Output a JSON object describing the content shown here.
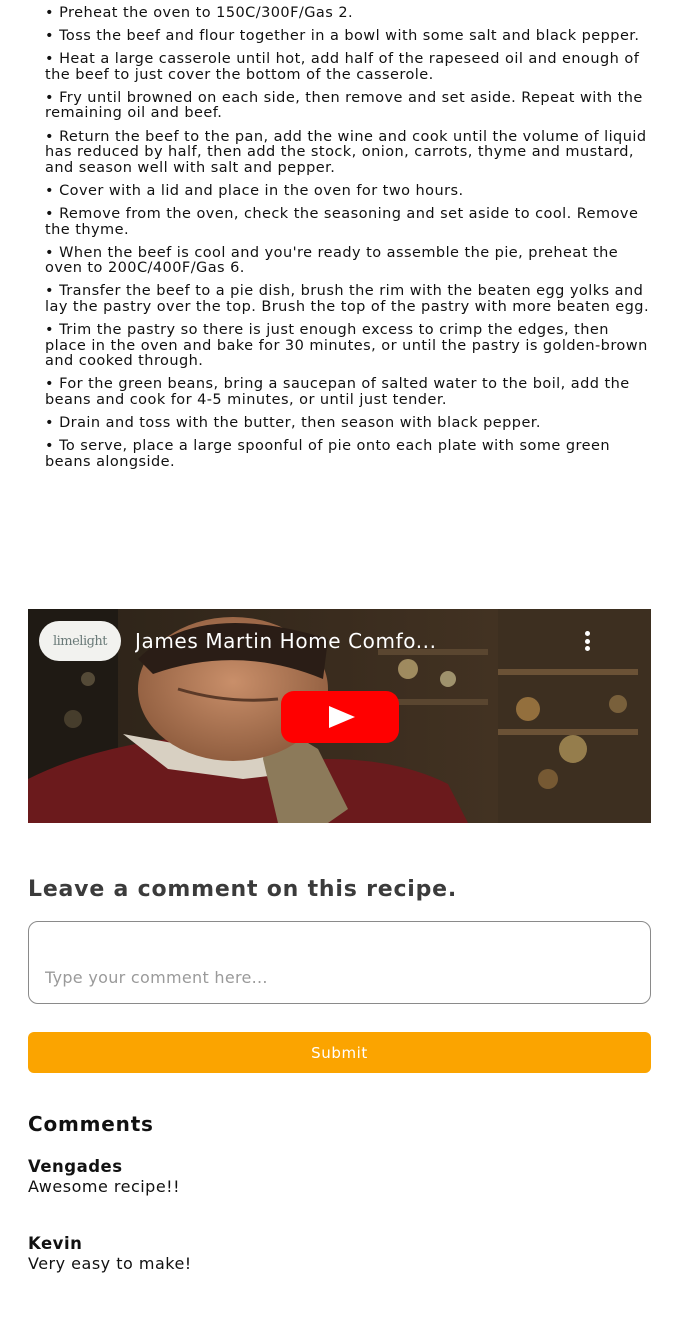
{
  "steps": [
    "Preheat the oven to 150C/300F/Gas 2.",
    "Toss the beef and flour together in a bowl with some salt and black pepper.",
    "Heat a large casserole until hot, add half of the rapeseed oil and enough of the beef to just cover the bottom of the casserole.",
    "Fry until browned on each side, then remove and set aside. Repeat with the remaining oil and beef.",
    "Return the beef to the pan, add the wine and cook until the volume of liquid has reduced by half, then add the stock, onion, carrots, thyme and mustard, and season well with salt and pepper.",
    "Cover with a lid and place in the oven for two hours.",
    "Remove from the oven, check the seasoning and set aside to cool. Remove the thyme.",
    "When the beef is cool and you're ready to assemble the pie, preheat the oven to 200C/400F/Gas 6.",
    "Transfer the beef to a pie dish, brush the rim with the beaten egg yolks and lay the pastry over the top. Brush the top of the pastry with more beaten egg.",
    "Trim the pastry so there is just enough excess to crimp the edges, then place in the oven and bake for 30 minutes, or until the pastry is golden-brown and cooked through.",
    "For the green beans, bring a saucepan of salted water to the boil, add the beans and cook for 4-5 minutes, or until just tender.",
    "Drain and toss with the butter, then season with black pepper.",
    "To serve, place a large spoonful of pie onto each plate with some green beans alongside."
  ],
  "video": {
    "title": "James Martin Home Comfo...",
    "channel_logo_text": "limelight",
    "icons": {
      "menu": "more-vertical-icon",
      "play": "play-icon"
    },
    "play_color": "#ff0000"
  },
  "comment_form": {
    "heading": "Leave a comment on this recipe.",
    "placeholder": "Type your comment here...",
    "submit_label": "Submit",
    "submit_color": "#fba400"
  },
  "comments": {
    "heading": "Comments",
    "items": [
      {
        "author": "Vengades",
        "text": "Awesome recipe!!"
      },
      {
        "author": "Kevin",
        "text": "Very easy to make!"
      }
    ]
  }
}
